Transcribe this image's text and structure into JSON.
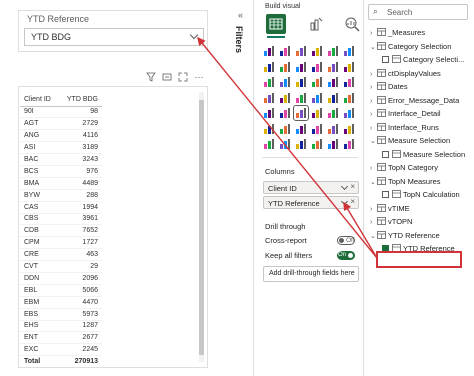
{
  "slicer": {
    "title": "YTD Reference",
    "selected": "YTD BDG"
  },
  "visual_header_icons": [
    "filter-icon",
    "focus-mode-icon",
    "expand-icon",
    "more-options-icon"
  ],
  "table": {
    "columns": [
      "Client ID",
      "YTD BDG"
    ],
    "rows": [
      [
        "90I",
        "98"
      ],
      [
        "AGT",
        "2729"
      ],
      [
        "ANG",
        "4116"
      ],
      [
        "ASI",
        "3189"
      ],
      [
        "BAC",
        "3243"
      ],
      [
        "BCS",
        "976"
      ],
      [
        "BMA",
        "4489"
      ],
      [
        "BYW",
        "288"
      ],
      [
        "CAS",
        "1994"
      ],
      [
        "CBS",
        "3961"
      ],
      [
        "CDB",
        "7652"
      ],
      [
        "CPM",
        "1727"
      ],
      [
        "CRE",
        "463"
      ],
      [
        "CVT",
        "29"
      ],
      [
        "DDN",
        "2096"
      ],
      [
        "EBL",
        "5066"
      ],
      [
        "EBM",
        "4470"
      ],
      [
        "EBS",
        "5973"
      ],
      [
        "EHS",
        "1287"
      ],
      [
        "ENT",
        "2677"
      ],
      [
        "EXC",
        "2245"
      ]
    ],
    "total": [
      "Total",
      "270913"
    ]
  },
  "filters_pane": {
    "label": "Filters"
  },
  "visualizations": {
    "build_visual_label": "Build visual",
    "columns_label": "Columns",
    "column_wells": [
      {
        "label": "Client ID"
      },
      {
        "label": "YTD Reference"
      }
    ],
    "drill_through_label": "Drill through",
    "cross_report": {
      "label": "Cross-report",
      "state": "Off"
    },
    "keep_all_filters": {
      "label": "Keep all filters",
      "state": "On"
    },
    "add_drill_label": "Add drill-through fields here"
  },
  "data_pane": {
    "search_placeholder": "Search",
    "tree": [
      {
        "label": "_Measures",
        "level": 0,
        "chev": "›",
        "icon": "table"
      },
      {
        "label": "Category Selection",
        "level": 0,
        "chev": "⌄",
        "icon": "table"
      },
      {
        "label": "Category Selecti...",
        "level": 1,
        "icon": "field",
        "checkbox": false
      },
      {
        "label": "ctDisplayValues",
        "level": 0,
        "chev": "›",
        "icon": "table"
      },
      {
        "label": "Dates",
        "level": 0,
        "chev": "›",
        "icon": "table"
      },
      {
        "label": "Error_Message_Data",
        "level": 0,
        "chev": "›",
        "icon": "table"
      },
      {
        "label": "Interface_Detail",
        "level": 0,
        "chev": "›",
        "icon": "table"
      },
      {
        "label": "Interface_Runs",
        "level": 0,
        "chev": "›",
        "icon": "table"
      },
      {
        "label": "Measure Selection",
        "level": 0,
        "chev": "⌄",
        "icon": "table"
      },
      {
        "label": "Measure Selection",
        "level": 1,
        "icon": "field",
        "checkbox": false
      },
      {
        "label": "TopN Category",
        "level": 0,
        "chev": "›",
        "icon": "table"
      },
      {
        "label": "TopN Measures",
        "level": 0,
        "chev": "⌄",
        "icon": "table"
      },
      {
        "label": "TopN Calculation",
        "level": 1,
        "icon": "field",
        "checkbox": false
      },
      {
        "label": "vTIME",
        "level": 0,
        "chev": "›",
        "icon": "table"
      },
      {
        "label": "vTOPN",
        "level": 0,
        "chev": "›",
        "icon": "table"
      },
      {
        "label": "YTD Reference",
        "level": 0,
        "chev": "⌄",
        "icon": "table"
      },
      {
        "label": "YTD Reference",
        "level": 1,
        "icon": "field",
        "checkbox": true
      }
    ]
  },
  "colors": {
    "accent_green": "#1d6d3a",
    "annotation_red": "#d13438"
  }
}
